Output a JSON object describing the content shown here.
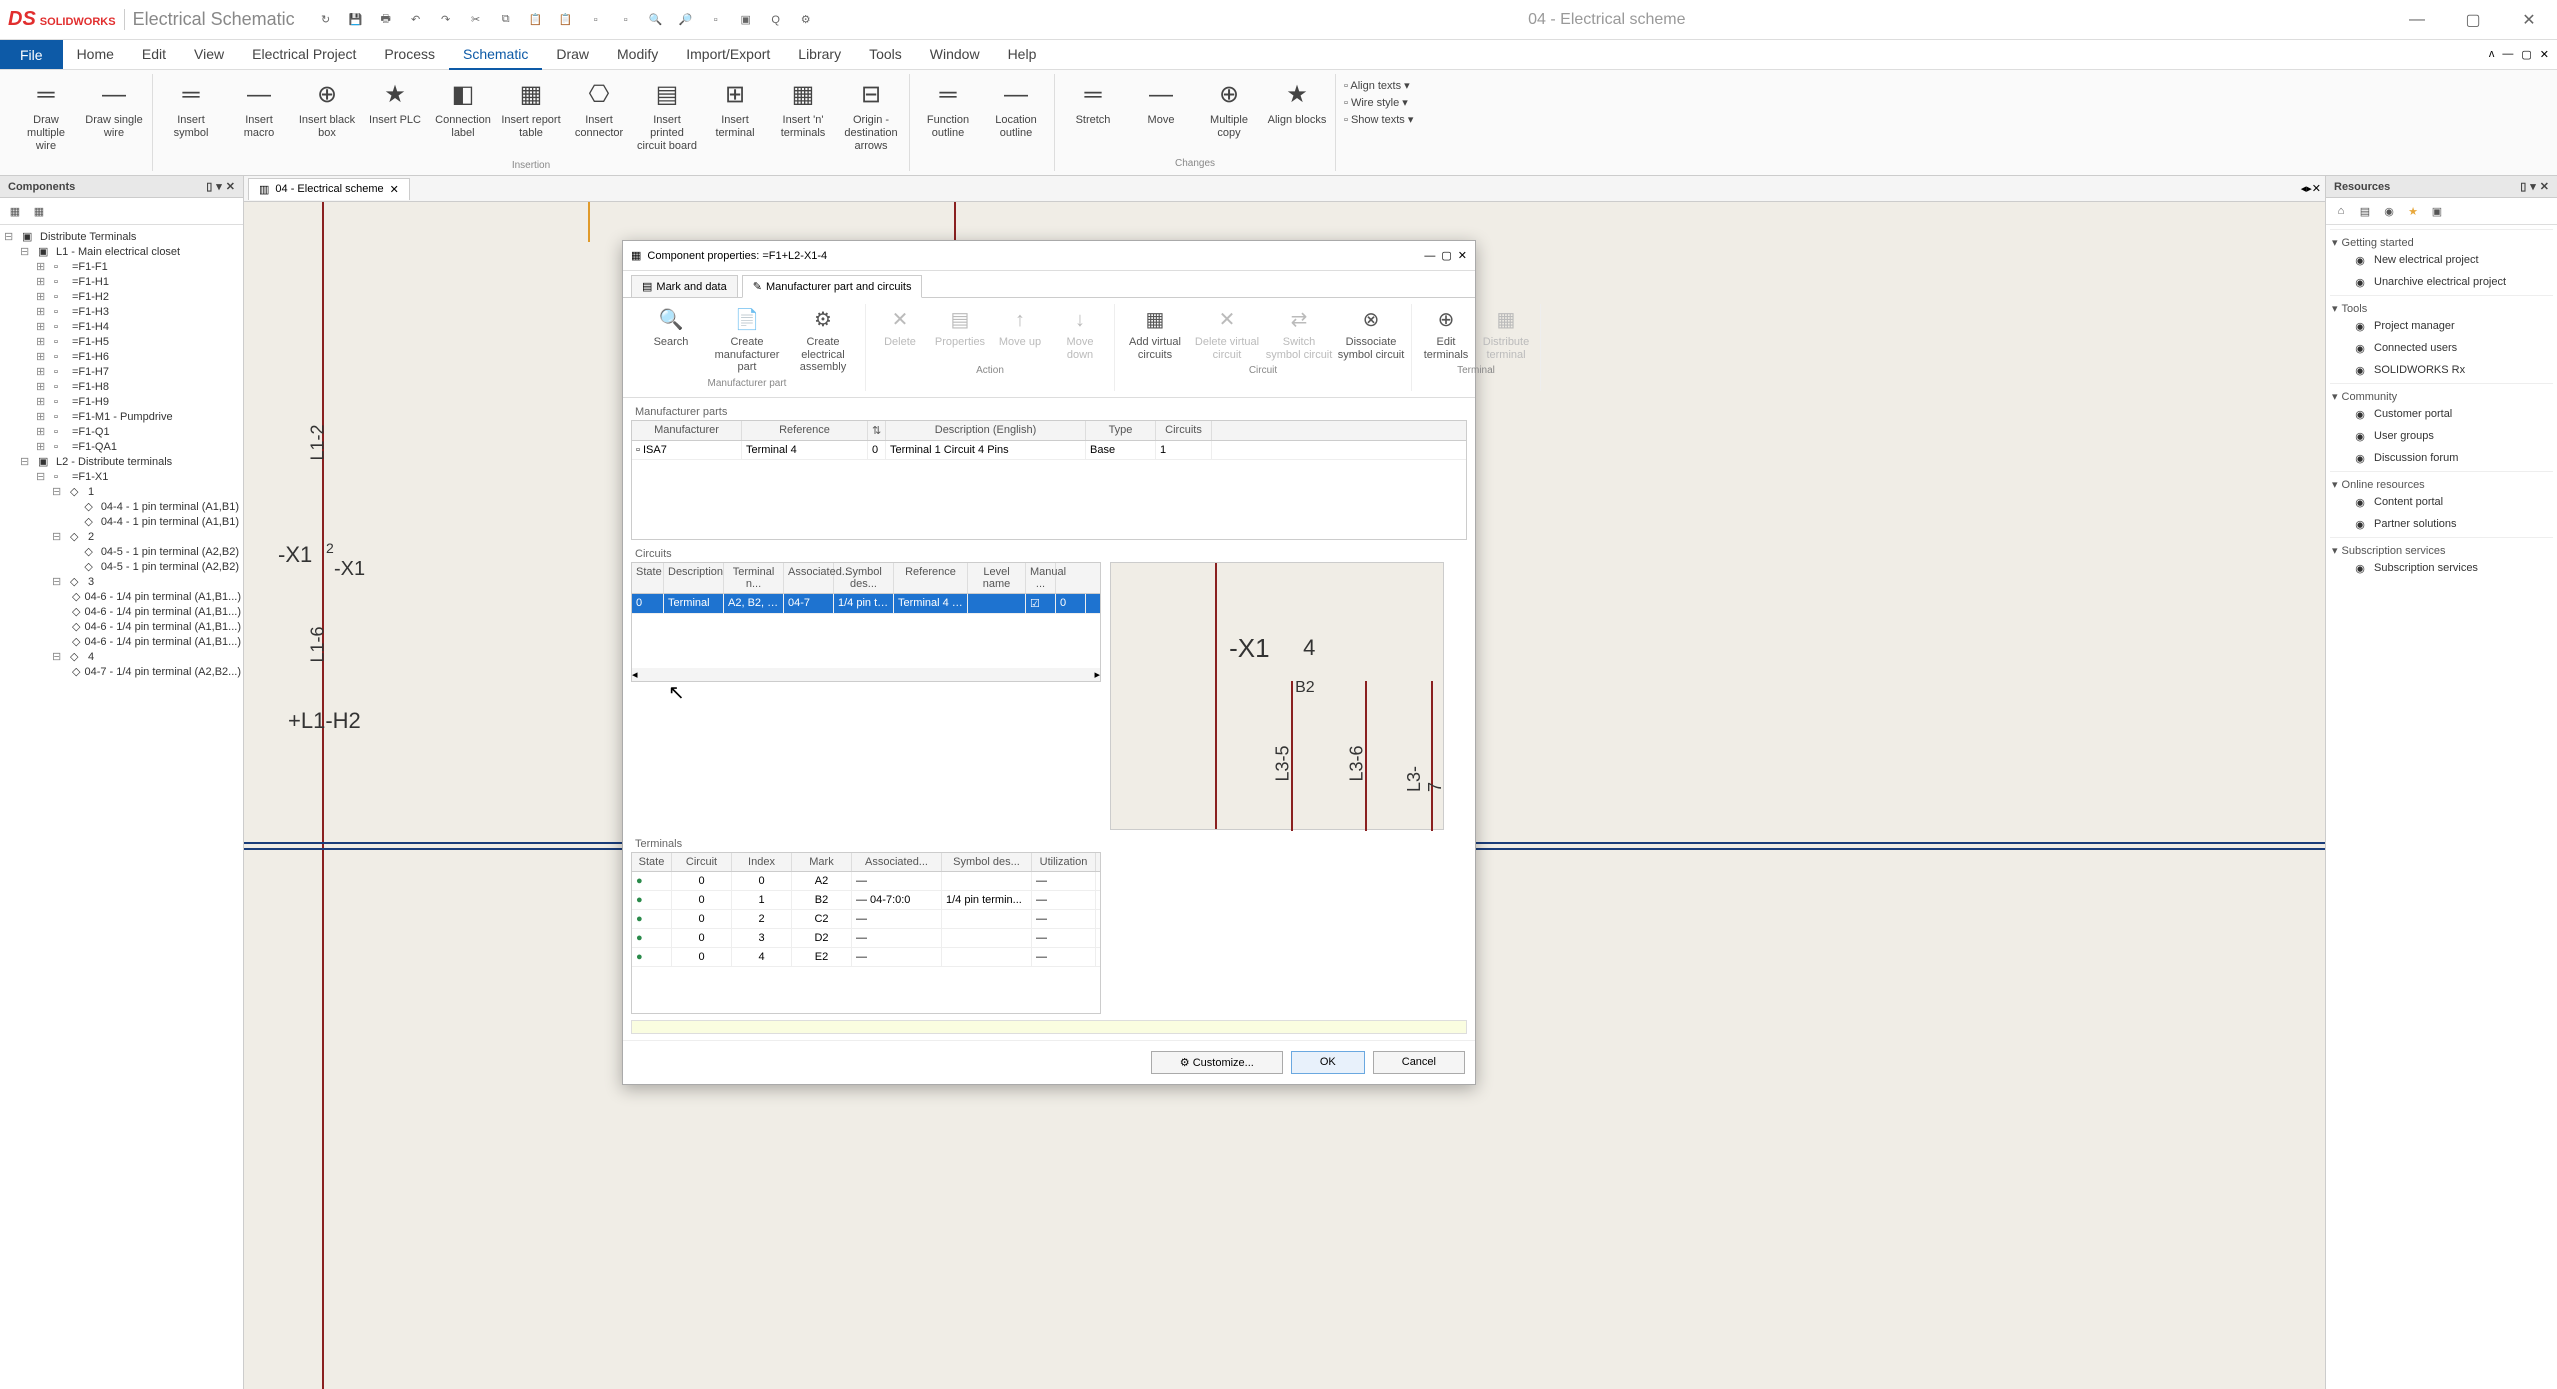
{
  "app": {
    "brand1": "SOLID",
    "brand2": "WORKS",
    "sub": "Electrical Schematic",
    "doc_title": "04 - Electrical scheme"
  },
  "menu": {
    "file": "File",
    "items": [
      "Home",
      "Edit",
      "View",
      "Electrical Project",
      "Process",
      "Schematic",
      "Draw",
      "Modify",
      "Import/Export",
      "Library",
      "Tools",
      "Window",
      "Help"
    ],
    "active": "Schematic"
  },
  "ribbon": {
    "g1": [
      {
        "l": "Draw multiple wire"
      },
      {
        "l": "Draw single wire"
      }
    ],
    "g2": [
      {
        "l": "Insert symbol"
      },
      {
        "l": "Insert macro"
      },
      {
        "l": "Insert black box"
      },
      {
        "l": "Insert PLC"
      },
      {
        "l": "Connection label"
      },
      {
        "l": "Insert report table"
      },
      {
        "l": "Insert connector"
      },
      {
        "l": "Insert printed circuit board"
      },
      {
        "l": "Insert terminal"
      },
      {
        "l": "Insert 'n' terminals"
      },
      {
        "l": "Origin - destination arrows"
      }
    ],
    "g2_label": "Insertion",
    "g3": [
      {
        "l": "Function outline"
      },
      {
        "l": "Location outline"
      }
    ],
    "g4": [
      {
        "l": "Stretch"
      },
      {
        "l": "Move"
      },
      {
        "l": "Multiple copy"
      },
      {
        "l": "Align blocks"
      }
    ],
    "g4_label": "Changes",
    "g5": [
      "Align texts",
      "Wire style",
      "Show texts"
    ]
  },
  "components": {
    "title": "Components",
    "root": "Distribute Terminals",
    "l1": "L1 - Main electrical closet",
    "nodes1": [
      "=F1-F1",
      "=F1-H1",
      "=F1-H2",
      "=F1-H3",
      "=F1-H4",
      "=F1-H5",
      "=F1-H6",
      "=F1-H7",
      "=F1-H8",
      "=F1-H9",
      "=F1-M1 - Pumpdrive",
      "=F1-Q1",
      "=F1-QA1"
    ],
    "l2": "L2 - Distribute terminals",
    "x1": "=F1-X1",
    "sub1": "1",
    "sub1_items": [
      "04-4 - 1 pin terminal (A1,B1)",
      "04-4 - 1 pin terminal (A1,B1)"
    ],
    "sub2": "2",
    "sub2_items": [
      "04-5 - 1 pin terminal (A2,B2)",
      "04-5 - 1 pin terminal (A2,B2)"
    ],
    "sub3": "3",
    "sub3_items": [
      "04-6 - 1/4 pin terminal (A1,B1...)",
      "04-6 - 1/4 pin terminal (A1,B1...)",
      "04-6 - 1/4 pin terminal (A1,B1...)",
      "04-6 - 1/4 pin terminal (A1,B1...)"
    ],
    "sub4": "4",
    "sub4_items": [
      "04-7 - 1/4 pin terminal (A2,B2...)"
    ]
  },
  "doctab": {
    "label": "04 - Electrical scheme"
  },
  "canvas": {
    "l12": "L1-2",
    "l16": "L1-6",
    "x1a": "-X1",
    "x1b": "-X1",
    "x1num": "2",
    "l1h2": "+L1-H2"
  },
  "resources": {
    "title": "Resources",
    "s1": "Getting started",
    "s1_items": [
      "New electrical project",
      "Unarchive electrical project"
    ],
    "s2": "Tools",
    "s2_items": [
      "Project manager",
      "Connected users",
      "SOLIDWORKS Rx"
    ],
    "s3": "Community",
    "s3_items": [
      "Customer portal",
      "User groups",
      "Discussion forum"
    ],
    "s4": "Online resources",
    "s4_items": [
      "Content portal",
      "Partner solutions"
    ],
    "s5": "Subscription services",
    "s5_items": [
      "Subscription services"
    ]
  },
  "dialog": {
    "title": "Component properties: =F1+L2-X1-4",
    "tab1": "Mark and data",
    "tab2": "Manufacturer part and circuits",
    "rbn": {
      "g1": [
        "Search",
        "Create manufacturer part",
        "Create electrical assembly"
      ],
      "g1l": "Manufacturer part",
      "g2": [
        "Delete",
        "Properties",
        "Move up",
        "Move down"
      ],
      "g2l": "Action",
      "g3": [
        "Add virtual circuits",
        "Delete virtual circuit",
        "Switch symbol circuit",
        "Dissociate symbol circuit"
      ],
      "g3l": "Circuit",
      "g4": [
        "Edit terminals",
        "Distribute terminal"
      ],
      "g4l": "Terminal"
    },
    "mparts": {
      "title": "Manufacturer parts",
      "cols": [
        "Manufacturer",
        "Reference",
        "⇅",
        "Description (English)",
        "Type",
        "Circuits"
      ],
      "row": [
        "ISA7",
        "Terminal 4",
        "0",
        "Terminal 1 Circuit 4 Pins",
        "Base",
        "1"
      ]
    },
    "circuits": {
      "title": "Circuits",
      "cols": [
        "State",
        "Description",
        "Terminal n...",
        "Associated...",
        "Symbol des...",
        "Reference",
        "Level name",
        "Manual ..."
      ],
      "row": [
        "0",
        "Terminal",
        "A2, B2, C2, D...",
        "04-7",
        "1/4 pin termin...",
        "Terminal 4 (0)",
        "",
        "☑",
        "0"
      ]
    },
    "terminals": {
      "title": "Terminals",
      "cols": [
        "State",
        "Circuit",
        "Index",
        "Mark",
        "Associated...",
        "Symbol des...",
        "Utilization"
      ],
      "rows": [
        [
          "0",
          "0",
          "A2",
          "—",
          "",
          "—"
        ],
        [
          "0",
          "1",
          "B2",
          "—  04-7:0:0",
          "1/4 pin termin...",
          "—"
        ],
        [
          "0",
          "2",
          "C2",
          "—",
          "",
          "—"
        ],
        [
          "0",
          "3",
          "D2",
          "—",
          "",
          "—"
        ],
        [
          "0",
          "4",
          "E2",
          "—",
          "",
          "—"
        ]
      ]
    },
    "preview": {
      "x1": "-X1",
      "num": "4",
      "b2": "B2",
      "l35": "L3-5",
      "l36": "L3-6",
      "l37": "L3-7"
    },
    "btn_customize": "Customize...",
    "btn_ok": "OK",
    "btn_cancel": "Cancel"
  }
}
